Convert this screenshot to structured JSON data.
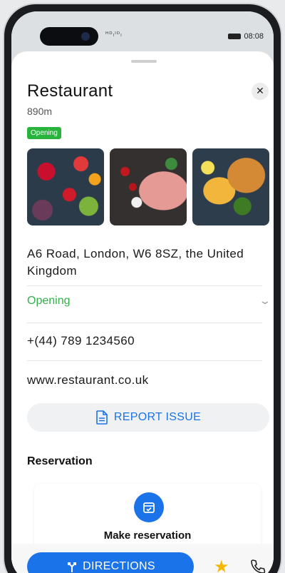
{
  "status_bar": {
    "signal_text": "ᴴᴰₗᴵᴰₗ",
    "time": "08:08"
  },
  "place": {
    "title": "Restaurant",
    "distance": "890m",
    "status_badge": "Opening",
    "address": "A6 Road, London, W6 8SZ, the United Kingdom",
    "opening_label": "Opening",
    "phone": "+(44) 789 1234560",
    "website": "www.restaurant.co.uk"
  },
  "photos": [
    {
      "name": "fruit-photo"
    },
    {
      "name": "meat-photo"
    },
    {
      "name": "fish-and-chips-photo"
    }
  ],
  "actions": {
    "report_issue": "REPORT ISSUE",
    "reservation_section": "Reservation",
    "make_reservation": "Make reservation",
    "directions": "DIRECTIONS"
  },
  "icons": {
    "close": "close-icon",
    "chevron": "chevron-down-icon",
    "report": "document-icon",
    "calendar": "calendar-check-icon",
    "directions": "directions-arrow-icon",
    "favorite": "star-icon",
    "call": "phone-icon"
  },
  "colors": {
    "accent": "#1a73e8",
    "opening_green": "#33b04a",
    "badge_green": "#28b43c",
    "star": "#f5b800"
  }
}
